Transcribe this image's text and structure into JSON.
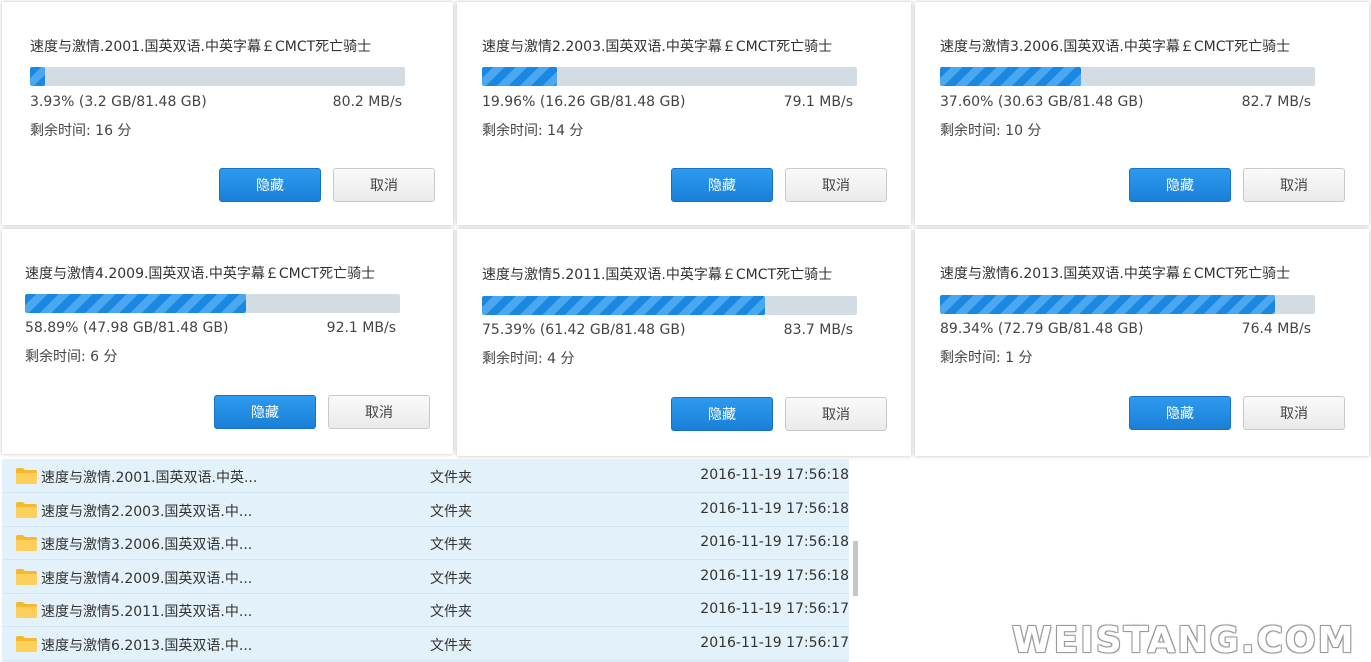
{
  "dialogs": [
    {
      "title": "速度与激情.2001.国英双语.中英字幕￡CMCT死亡骑士",
      "progress": 3.93,
      "progress_text": "3.93% (3.2 GB/81.48 GB)",
      "speed": "80.2 MB/s",
      "remaining": "剩余时间: 16 分",
      "hide_label": "隐藏",
      "cancel_label": "取消"
    },
    {
      "title": "速度与激情2.2003.国英双语.中英字幕￡CMCT死亡骑士",
      "progress": 19.96,
      "progress_text": "19.96% (16.26 GB/81.48 GB)",
      "speed": "79.1 MB/s",
      "remaining": "剩余时间: 14 分",
      "hide_label": "隐藏",
      "cancel_label": "取消"
    },
    {
      "title": "速度与激情3.2006.国英双语.中英字幕￡CMCT死亡骑士",
      "progress": 37.6,
      "progress_text": "37.60% (30.63 GB/81.48 GB)",
      "speed": "82.7 MB/s",
      "remaining": "剩余时间: 10 分",
      "hide_label": "隐藏",
      "cancel_label": "取消"
    },
    {
      "title": "速度与激情4.2009.国英双语.中英字幕￡CMCT死亡骑士",
      "progress": 58.89,
      "progress_text": "58.89% (47.98 GB/81.48 GB)",
      "speed": "92.1 MB/s",
      "remaining": "剩余时间: 6 分",
      "hide_label": "隐藏",
      "cancel_label": "取消"
    },
    {
      "title": "速度与激情5.2011.国英双语.中英字幕￡CMCT死亡骑士",
      "progress": 75.39,
      "progress_text": "75.39% (61.42 GB/81.48 GB)",
      "speed": "83.7 MB/s",
      "remaining": "剩余时间: 4 分",
      "hide_label": "隐藏",
      "cancel_label": "取消"
    },
    {
      "title": "速度与激情6.2013.国英双语.中英字幕￡CMCT死亡骑士",
      "progress": 89.34,
      "progress_text": "89.34% (72.79 GB/81.48 GB)",
      "speed": "76.4 MB/s",
      "remaining": "剩余时间: 1 分",
      "hide_label": "隐藏",
      "cancel_label": "取消"
    }
  ],
  "files": [
    {
      "name": "速度与激情.2001.国英双语.中英...",
      "type": "文件夹",
      "date": "2016-11-19 17:56:18"
    },
    {
      "name": "速度与激情2.2003.国英双语.中...",
      "type": "文件夹",
      "date": "2016-11-19 17:56:18"
    },
    {
      "name": "速度与激情3.2006.国英双语.中...",
      "type": "文件夹",
      "date": "2016-11-19 17:56:18"
    },
    {
      "name": "速度与激情4.2009.国英双语.中...",
      "type": "文件夹",
      "date": "2016-11-19 17:56:18"
    },
    {
      "name": "速度与激情5.2011.国英双语.中...",
      "type": "文件夹",
      "date": "2016-11-19 17:56:17"
    },
    {
      "name": "速度与激情6.2013.国英双语.中...",
      "type": "文件夹",
      "date": "2016-11-19 17:56:17"
    }
  ],
  "watermark": "WEISTANG.COM",
  "colors": {
    "accent": "#1a87e0",
    "track": "#d3dbe3",
    "list_bg": "#e3f1fb",
    "folder": "#f5b82e"
  },
  "icons": {
    "folder": "folder-icon"
  }
}
